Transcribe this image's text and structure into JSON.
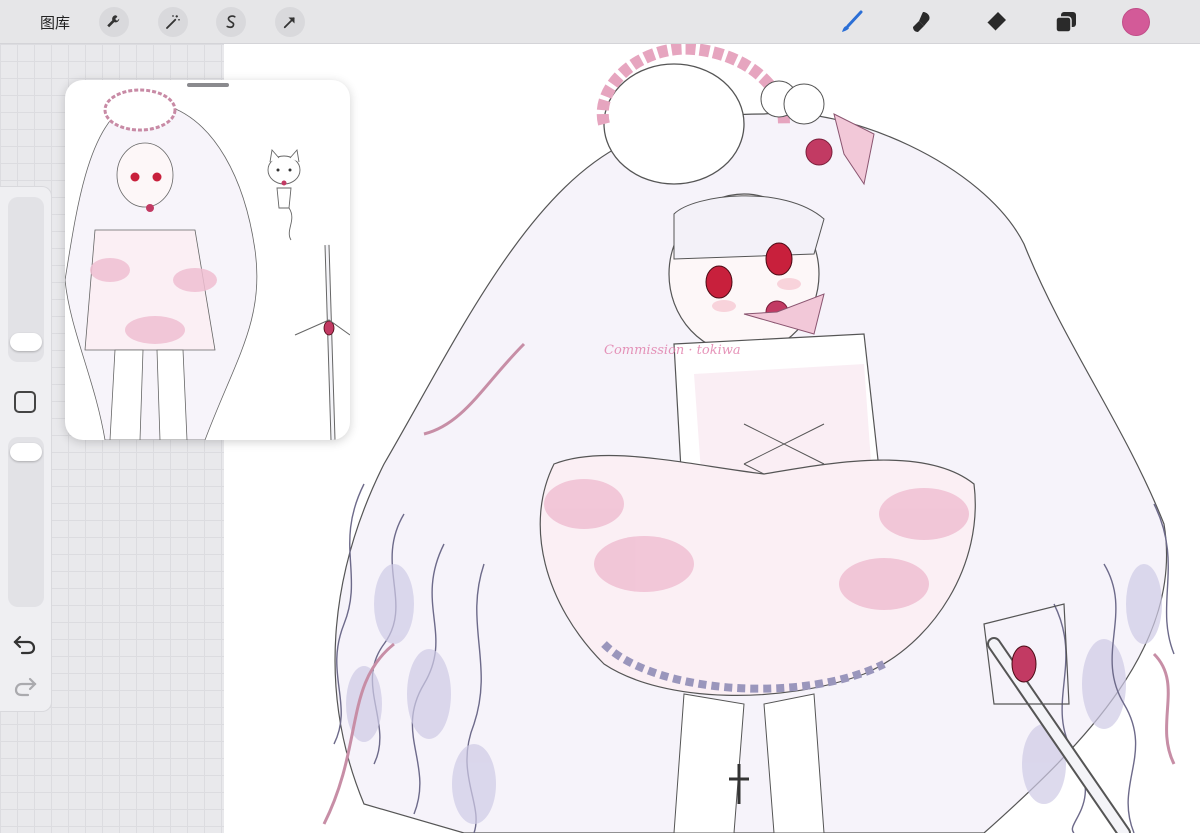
{
  "topbar": {
    "gallery_label": "图库",
    "left_tools": [
      "wrench-icon",
      "magic-wand-icon",
      "selection-icon",
      "transform-arrow-icon"
    ],
    "right_tools": [
      "brush-icon",
      "smudge-icon",
      "eraser-icon",
      "layers-icon"
    ],
    "active_tool": "brush-icon",
    "accent_color": "#2b6fd6",
    "current_color": "#d35a98"
  },
  "sidebar": {
    "controls": [
      "brush-size-slider",
      "modify-button",
      "opacity-slider",
      "undo-button",
      "redo-button"
    ]
  },
  "reference_window": {
    "contents": "reference-image"
  },
  "canvas": {
    "watermark_text": "Commission · tokiwa"
  },
  "colors": {
    "toolbar_bg": "#e6e6e8",
    "canvas_bg": "#ffffff",
    "hair_pink": "#f2c8d8",
    "rose": "#c23a63",
    "shadow_lavender": "#b8b4d6"
  }
}
